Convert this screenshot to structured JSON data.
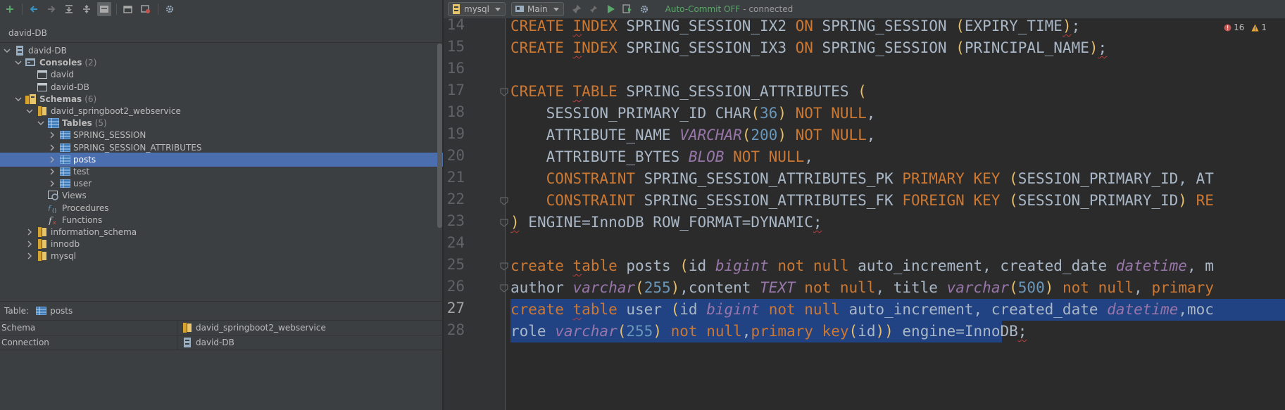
{
  "left_panel": {
    "datasource_label": "david-DB",
    "tree": [
      {
        "label": "david-DB",
        "indent": 0,
        "expanded": true,
        "icon": "datasource-icon"
      },
      {
        "label": "Consoles",
        "count": "(2)",
        "indent": 1,
        "expanded": true,
        "icon": "consoles-icon",
        "bold": true
      },
      {
        "label": "david",
        "indent": 2,
        "icon": "console-icon"
      },
      {
        "label": "david-DB",
        "indent": 2,
        "icon": "console-icon"
      },
      {
        "label": "Schemas",
        "count": "(6)",
        "indent": 1,
        "expanded": true,
        "icon": "schemas-icon",
        "bold": true
      },
      {
        "label": "david_springboot2_webservice",
        "indent": 2,
        "expanded": true,
        "icon": "schema-icon"
      },
      {
        "label": "Tables",
        "count": "(5)",
        "indent": 3,
        "expanded": true,
        "icon": "tables-icon",
        "bold": true
      },
      {
        "label": "SPRING_SESSION",
        "indent": 4,
        "collapsed": true,
        "icon": "table-icon"
      },
      {
        "label": "SPRING_SESSION_ATTRIBUTES",
        "indent": 4,
        "collapsed": true,
        "icon": "table-icon"
      },
      {
        "label": "posts",
        "indent": 4,
        "collapsed": true,
        "icon": "table-icon",
        "selected": true
      },
      {
        "label": "test",
        "indent": 4,
        "collapsed": true,
        "icon": "table-icon"
      },
      {
        "label": "user",
        "indent": 4,
        "collapsed": true,
        "icon": "table-icon"
      },
      {
        "label": "Views",
        "indent": 3,
        "icon": "views-icon"
      },
      {
        "label": "Procedures",
        "indent": 3,
        "icon": "procedures-icon"
      },
      {
        "label": "Functions",
        "indent": 3,
        "icon": "functions-icon"
      },
      {
        "label": "information_schema",
        "indent": 2,
        "collapsed": true,
        "icon": "schema-icon"
      },
      {
        "label": "innodb",
        "indent": 2,
        "collapsed": true,
        "icon": "schema-icon"
      },
      {
        "label": "mysql",
        "indent": 2,
        "collapsed": true,
        "icon": "schema-icon"
      }
    ],
    "details": {
      "header_label": "Table:",
      "header_value": "posts",
      "rows": [
        {
          "key": "Schema",
          "value": "david_springboot2_webservice"
        },
        {
          "key": "Connection",
          "value": "david-DB"
        }
      ]
    }
  },
  "editor": {
    "toolbar": {
      "dialect": "mysql",
      "session": "Main",
      "autocommit": "Auto-Commit OFF",
      "status": "- connected"
    },
    "inspections": {
      "errors": "16",
      "warnings": "1"
    },
    "current_line": 27,
    "lines": [
      {
        "n": "14"
      },
      {
        "n": "15"
      },
      {
        "n": "16"
      },
      {
        "n": "17"
      },
      {
        "n": "18"
      },
      {
        "n": "19"
      },
      {
        "n": "20"
      },
      {
        "n": "21"
      },
      {
        "n": "22"
      },
      {
        "n": "23"
      },
      {
        "n": "24"
      },
      {
        "n": "25"
      },
      {
        "n": "26"
      },
      {
        "n": "27"
      },
      {
        "n": "28"
      }
    ],
    "code": [
      [
        [
          "kw",
          "CREATE "
        ],
        [
          "kw ul",
          "I"
        ],
        [
          "kw",
          "NDEX "
        ],
        [
          "",
          "SPRING_SESSION_IX2 "
        ],
        [
          "kw",
          "ON "
        ],
        [
          "",
          "SPRING_SESSION "
        ],
        [
          "par",
          "("
        ],
        [
          "",
          "EXPIRY_TIME"
        ],
        [
          "par",
          "ul",
          ")"
        ],
        [
          "",
          ";"
        ]
      ],
      [
        [
          "kw",
          "CREATE "
        ],
        [
          "kw ul",
          "I"
        ],
        [
          "kw",
          "NDEX "
        ],
        [
          "",
          "SPRING_SESSION_IX3 "
        ],
        [
          "kw",
          "ON "
        ],
        [
          "",
          "SPRING_SESSION "
        ],
        [
          "par",
          "("
        ],
        [
          "",
          "PRINCIPAL_NAME"
        ],
        [
          "par",
          ")"
        ],
        [
          "ul",
          ";"
        ]
      ],
      [],
      [
        [
          "kw",
          "CREATE "
        ],
        [
          "kw ul",
          "T"
        ],
        [
          "kw",
          "ABLE "
        ],
        [
          "",
          "SPRING_SESSION_ATTRIBUTES "
        ],
        [
          "par",
          "("
        ]
      ],
      [
        [
          "",
          "    SESSION_PRIMARY_ID CHAR"
        ],
        [
          "par",
          "("
        ],
        [
          "num",
          "36"
        ],
        [
          "par",
          ")"
        ],
        [
          "kw",
          " NOT NULL"
        ],
        [
          "",
          ","
        ]
      ],
      [
        [
          "",
          "    ATTRIBUTE_NAME "
        ],
        [
          "ty",
          "VARCHAR"
        ],
        [
          "par",
          "("
        ],
        [
          "num",
          "200"
        ],
        [
          "par",
          ")"
        ],
        [
          "kw",
          " NOT NULL"
        ],
        [
          "",
          ","
        ]
      ],
      [
        [
          "",
          "    ATTRIBUTE_BYTES "
        ],
        [
          "ty",
          "BLOB"
        ],
        [
          "kw",
          " NOT NULL"
        ],
        [
          "",
          ","
        ]
      ],
      [
        [
          "kw",
          "    CONSTRAINT "
        ],
        [
          "",
          "SPRING_SESSION_ATTRIBUTES_PK "
        ],
        [
          "kw",
          "PRIMARY KEY "
        ],
        [
          "par",
          "("
        ],
        [
          "",
          "SESSION_PRIMARY_ID, AT"
        ]
      ],
      [
        [
          "kw",
          "    CONSTRAINT "
        ],
        [
          "",
          "SPRING_SESSION_ATTRIBUTES_FK "
        ],
        [
          "kw",
          "FOREIGN KEY "
        ],
        [
          "par",
          "("
        ],
        [
          "",
          "SESSION_PRIMARY_ID"
        ],
        [
          "par",
          ")"
        ],
        [
          "kw",
          " RE"
        ]
      ],
      [
        [
          "par ul",
          ")"
        ],
        [
          "",
          " ENGINE=InnoDB ROW_FORMAT=DYNAMIC"
        ],
        [
          "ul",
          ";"
        ]
      ],
      [],
      [
        [
          "kw",
          "create "
        ],
        [
          "kw ul",
          "t"
        ],
        [
          "kw",
          "able "
        ],
        [
          "",
          "posts "
        ],
        [
          "par",
          "("
        ],
        [
          "",
          "id "
        ],
        [
          "ty",
          "bigint"
        ],
        [
          "kw",
          " not null "
        ],
        [
          "",
          "auto_increment, created_date "
        ],
        [
          "ty",
          "datetime"
        ],
        [
          "",
          ", m"
        ]
      ],
      [
        [
          "",
          "author "
        ],
        [
          "ty",
          "varchar"
        ],
        [
          "par",
          "("
        ],
        [
          "num",
          "255"
        ],
        [
          "par",
          ")"
        ],
        [
          "",
          ",content "
        ],
        [
          "ty",
          "TEXT"
        ],
        [
          "kw",
          " not null"
        ],
        [
          "",
          ", title "
        ],
        [
          "ty",
          "varchar"
        ],
        [
          "par",
          "("
        ],
        [
          "num",
          "500"
        ],
        [
          "par",
          ")"
        ],
        [
          "kw",
          " not null"
        ],
        [
          "",
          ", "
        ],
        [
          "kw",
          "primary"
        ]
      ],
      [
        [
          "kw",
          "create "
        ],
        [
          "kw ul",
          "t"
        ],
        [
          "kw",
          "able "
        ],
        [
          "",
          "user "
        ],
        [
          "par",
          "("
        ],
        [
          "",
          "id "
        ],
        [
          "ty",
          "bigint"
        ],
        [
          "kw",
          " not null "
        ],
        [
          "",
          "auto_increment, created_date "
        ],
        [
          "ty",
          "datetime"
        ],
        [
          "",
          ",moc"
        ]
      ],
      [
        [
          "",
          "role "
        ],
        [
          "ty",
          "varchar"
        ],
        [
          "par",
          "("
        ],
        [
          "num",
          "255"
        ],
        [
          "par",
          ")"
        ],
        [
          "kw",
          " not null"
        ],
        [
          "",
          ","
        ],
        [
          "kw",
          "primary key"
        ],
        [
          "par",
          "("
        ],
        [
          "",
          "id"
        ],
        [
          "par",
          "))"
        ],
        [
          "",
          " engine=InnoDB"
        ],
        [
          "ul",
          ";"
        ]
      ]
    ]
  }
}
